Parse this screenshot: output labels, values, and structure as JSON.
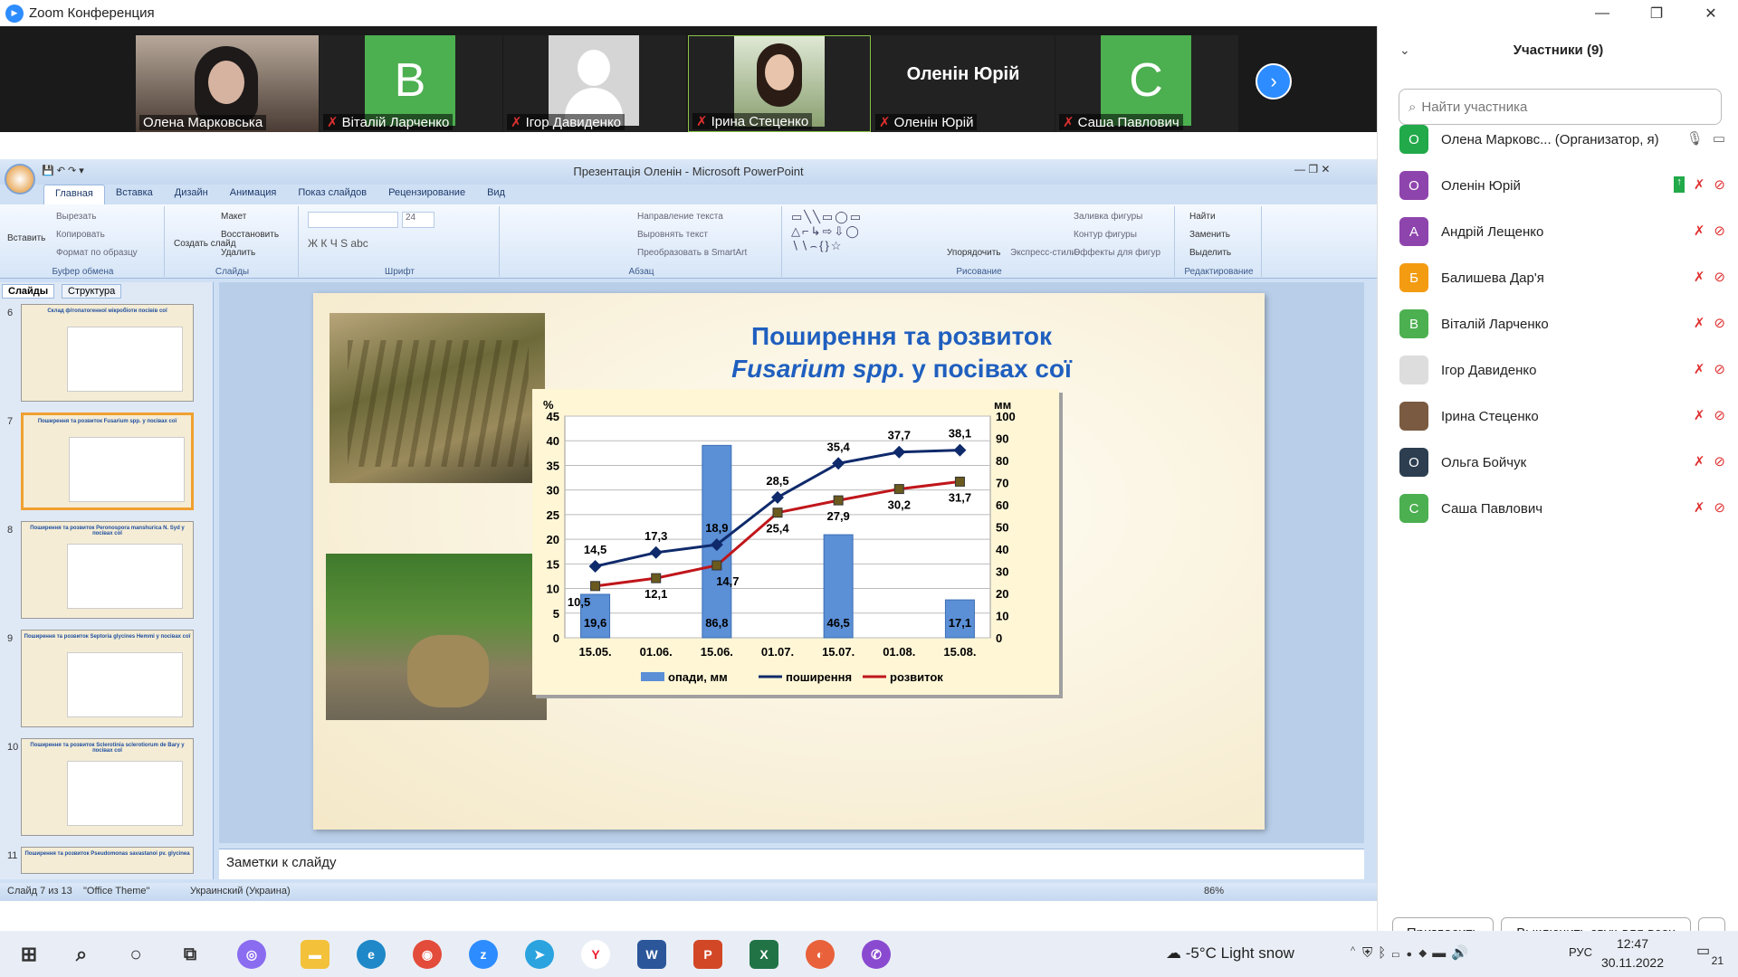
{
  "zoom": {
    "window_title": "Zoom Конференция",
    "participants_title": "Участники (9)",
    "search_placeholder": "Найти участника",
    "video_tiles": [
      {
        "name": "Олена Марковська",
        "type": "photo"
      },
      {
        "name": "Віталій Ларченко",
        "type": "letter",
        "letter": "В",
        "color": "#4caf50"
      },
      {
        "name": "Ігор Давиденко",
        "type": "silhouette"
      },
      {
        "name": "Ірина Стеценко",
        "type": "photo"
      },
      {
        "name": "Оленін Юрій",
        "type": "text",
        "label": "Оленін Юрій"
      },
      {
        "name": "Саша Павлович",
        "type": "letter",
        "letter": "С",
        "color": "#4caf50"
      }
    ],
    "participants": [
      {
        "initial": "О",
        "color": "#21a94a",
        "name": "Олена Марковс...  (Организатор, я)"
      },
      {
        "initial": "О",
        "color": "#8e44ad",
        "name": "Оленін Юрій"
      },
      {
        "initial": "А",
        "color": "#8e44ad",
        "name": "Андрій Лещенко"
      },
      {
        "initial": "Б",
        "color": "#f39c12",
        "name": "Балишева Дар'я"
      },
      {
        "initial": "В",
        "color": "#4caf50",
        "name": "Віталій Ларченко"
      },
      {
        "initial": "",
        "color": "#dddddd",
        "name": "Ігор Давиденко"
      },
      {
        "initial": "",
        "color": "#7a5a40",
        "name": "Ірина Стеценко"
      },
      {
        "initial": "О",
        "color": "#2c3e50",
        "name": "Ольга Бойчук"
      },
      {
        "initial": "С",
        "color": "#4caf50",
        "name": "Саша Павлович"
      }
    ],
    "invite_button": "Пригласить",
    "mute_all_button": "Выключить звук для всех",
    "more_button": "..."
  },
  "ppt": {
    "window_title": "Презентація Оленін - Microsoft PowerPoint",
    "tabs": [
      "Главная",
      "Вставка",
      "Дизайн",
      "Анимация",
      "Показ слайдов",
      "Рецензирование",
      "Вид"
    ],
    "groups": {
      "clipboard": "Буфер обмена",
      "slides": "Слайды",
      "font": "Шрифт",
      "paragraph": "Абзац",
      "drawing": "Рисование",
      "editing": "Редактирование"
    },
    "buttons": {
      "paste": "Вставить",
      "cut": "Вырезать",
      "copy": "Копировать",
      "format_painter": "Формат по образцу",
      "new_slide": "Создать слайд",
      "layout": "Макет",
      "reset": "Восстановить",
      "delete": "Удалить",
      "font_size": "24",
      "text_direction": "Направление текста",
      "align_text": "Выровнять текст",
      "smartart": "Преобразовать в SmartArt",
      "arrange": "Упорядочить",
      "quick_styles": "Экспресс-стили",
      "shape_fill": "Заливка фигуры",
      "shape_outline": "Контур фигуры",
      "shape_effects": "Эффекты для фигур",
      "find": "Найти",
      "replace": "Заменить",
      "select": "Выделить"
    },
    "pane_tabs": [
      "Слайды",
      "Структура"
    ],
    "thumbnails": [
      {
        "num": "6",
        "title": "Склад фітопатогенної мікробіоти посівів сої"
      },
      {
        "num": "7",
        "title": "Поширення та розвиток Fusarium spp. у посівах сої"
      },
      {
        "num": "8",
        "title": "Поширення та розвиток Peronospora manshurica N. Syd у посівах сої"
      },
      {
        "num": "9",
        "title": "Поширення та розвиток Septoria glycines Hemmi у посівах сої"
      },
      {
        "num": "10",
        "title": "Поширення та розвиток Sclerotinia sclerotiorum de Bary у посівах сої"
      },
      {
        "num": "11",
        "title": "Поширення та розвиток Pseudomonas savastanoi pv. glycinea"
      }
    ],
    "notes_placeholder": "Заметки к слайду",
    "status": {
      "slide": "Слайд 7 из 13",
      "theme": "\"Office Theme\"",
      "language": "Украинский (Украина)",
      "zoom": "86%"
    }
  },
  "slide": {
    "title_line1": "Поширення та розвиток",
    "title_italic": "Fusarium spp",
    "title_rest": ". у посівах сої"
  },
  "chart_data": {
    "type": "bar",
    "categories": [
      "15.05.",
      "01.06.",
      "15.06.",
      "01.07.",
      "15.07.",
      "01.08.",
      "15.08."
    ],
    "y_left_label": "%",
    "y_right_label": "мм",
    "y_left_range": [
      0,
      45
    ],
    "y_left_ticks": [
      "0",
      "5",
      "10",
      "15",
      "20",
      "25",
      "30",
      "35",
      "40",
      "45"
    ],
    "y_right_range": [
      0,
      100
    ],
    "y_right_ticks": [
      "0",
      "10",
      "20",
      "30",
      "40",
      "50",
      "60",
      "70",
      "80",
      "90",
      "100"
    ],
    "series": [
      {
        "name": "опади, мм",
        "kind": "bar",
        "axis": "right",
        "color": "#5b8fd6",
        "values": [
          19.6,
          null,
          86.8,
          null,
          46.5,
          null,
          17.1
        ],
        "labels": [
          "19,6",
          "",
          "86,8",
          "",
          "46,5",
          "",
          "17,1"
        ]
      },
      {
        "name": "поширення",
        "kind": "line",
        "axis": "left",
        "color": "#0f2a6b",
        "values": [
          14.5,
          17.3,
          18.9,
          28.5,
          35.4,
          37.7,
          38.1
        ],
        "labels": [
          "14,5",
          "17,3",
          "18,9",
          "28,5",
          "35,4",
          "37,7",
          "38,1"
        ]
      },
      {
        "name": "розвиток",
        "kind": "line",
        "axis": "left",
        "color": "#c0161b",
        "values": [
          10.5,
          12.1,
          14.7,
          25.4,
          27.9,
          30.2,
          31.7
        ],
        "labels": [
          "10,5",
          "12,1",
          "14,7",
          "25,4",
          "27,9",
          "30,2",
          "31,7"
        ]
      }
    ],
    "legend_placement": "bottom"
  },
  "taskbar": {
    "weather": "-5°C  Light snow",
    "lang": "РУС",
    "time": "12:47",
    "date": "30.11.2022",
    "notifications": "21"
  }
}
